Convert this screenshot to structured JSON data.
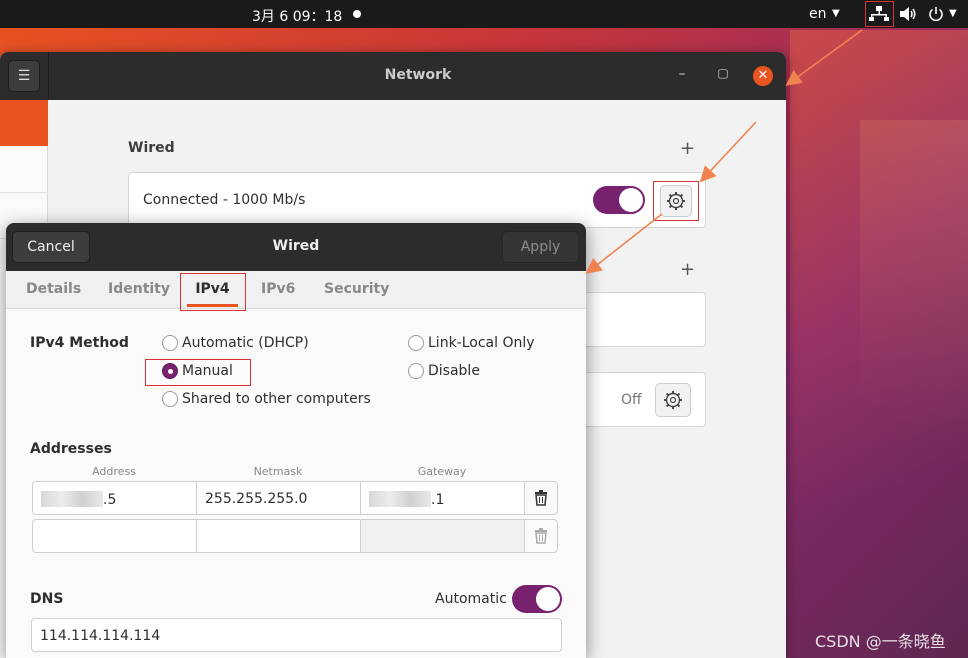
{
  "top_bar": {
    "clock": "3月 6 09：18",
    "language": "en"
  },
  "network_window": {
    "title": "Network",
    "wired_section": {
      "title": "Wired",
      "status": "Connected - 1000 Mb/s",
      "enabled": true
    },
    "proxy_status": "Off"
  },
  "wired_dialog": {
    "title": "Wired",
    "cancel_label": "Cancel",
    "apply_label": "Apply",
    "tabs": [
      {
        "label": "Details"
      },
      {
        "label": "Identity"
      },
      {
        "label": "IPv4"
      },
      {
        "label": "IPv6"
      },
      {
        "label": "Security"
      }
    ],
    "active_tab": "IPv4",
    "ipv4_method": {
      "label": "IPv4 Method",
      "selected": "Manual",
      "options": [
        {
          "label": "Automatic (DHCP)"
        },
        {
          "label": "Manual"
        },
        {
          "label": "Shared to other computers"
        },
        {
          "label": "Link-Local Only"
        },
        {
          "label": "Disable"
        }
      ]
    },
    "addresses": {
      "label": "Addresses",
      "columns": [
        "Address",
        "Netmask",
        "Gateway"
      ],
      "rows": [
        {
          "address_suffix": ".5",
          "netmask": "255.255.255.0",
          "gateway_suffix": ".1"
        },
        {
          "address_suffix": "",
          "netmask": "",
          "gateway_suffix": ""
        }
      ]
    },
    "dns": {
      "label": "DNS",
      "automatic_label": "Automatic",
      "automatic_enabled": true,
      "value": "114.114.114.114"
    }
  },
  "watermark": "CSDN @一条晓鱼",
  "colors": {
    "accent_orange": "#e95420",
    "toggle_purple": "#77216f",
    "annotation_red": "#d83333",
    "arrow_orange": "#f0834f"
  }
}
